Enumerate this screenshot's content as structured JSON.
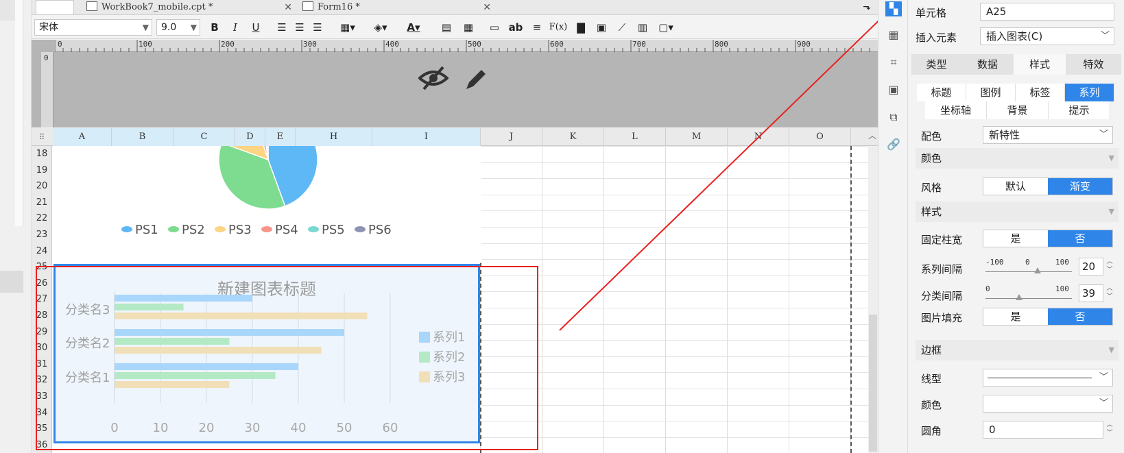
{
  "tabs": [
    {
      "label": "WorkBook7_mobile.cpt *"
    },
    {
      "label": "Form16 *"
    }
  ],
  "toolbar": {
    "font": "宋体",
    "size": "9.0",
    "bold": "B",
    "italic": "I",
    "underline": "U",
    "text_ab": "ab",
    "formula": "F(x)"
  },
  "ruler": {
    "ticks": [
      "0",
      "100",
      "200",
      "300",
      "400",
      "500",
      "600",
      "700",
      "800",
      "900"
    ],
    "vzero": "0"
  },
  "columns": [
    "A",
    "B",
    "C",
    "D",
    "E",
    "H",
    "I",
    "J",
    "K",
    "L",
    "M",
    "N",
    "O"
  ],
  "rows": [
    "18",
    "19",
    "20",
    "21",
    "22",
    "23",
    "24",
    "25",
    "26",
    "27",
    "28",
    "29",
    "30",
    "31",
    "32",
    "33",
    "34",
    "35",
    "36"
  ],
  "pie_legend": [
    "PS1",
    "PS2",
    "PS3",
    "PS4",
    "PS5",
    "PS6"
  ],
  "pie_colors": [
    "#5db8f5",
    "#7ddc8f",
    "#fcd482",
    "#f7958a",
    "#79d8cf",
    "#8d93b5"
  ],
  "chart_data": {
    "type": "bar",
    "title": "新建图表标题",
    "categories": [
      "分类名1",
      "分类名2",
      "分类名3"
    ],
    "series": [
      {
        "name": "系列1",
        "values": [
          40,
          50,
          30
        ],
        "color": "#a9d6fb"
      },
      {
        "name": "系列2",
        "values": [
          35,
          25,
          15
        ],
        "color": "#b3e9c5"
      },
      {
        "name": "系列3",
        "values": [
          25,
          45,
          55
        ],
        "color": "#f1dfb8"
      }
    ],
    "xlim": [
      0,
      60
    ],
    "xticks": [
      "0",
      "10",
      "20",
      "30",
      "40",
      "50",
      "60"
    ],
    "orientation": "horizontal",
    "legend": "right"
  },
  "panel": {
    "cell_label": "单元格",
    "cell_value": "A25",
    "insert_label": "插入元素",
    "insert_value": "插入图表(C)",
    "main_tabs": [
      "类型",
      "数据",
      "样式",
      "特效"
    ],
    "sub_tabs_row1": [
      "标题",
      "图例",
      "标签",
      "系列"
    ],
    "sub_tabs_row2": [
      "坐标轴",
      "背景",
      "提示"
    ],
    "color_scheme_label": "配色",
    "color_scheme_value": "新特性",
    "color_section": "颜色",
    "style_label": "风格",
    "style_options": [
      "默认",
      "渐变"
    ],
    "style_section": "样式",
    "fixed_width_label": "固定柱宽",
    "yes": "是",
    "no": "否",
    "series_gap_label": "系列间隔",
    "series_gap_min": "-100",
    "series_gap_mid": "0",
    "series_gap_max": "100",
    "series_gap_value": "20",
    "category_gap_label": "分类间隔",
    "category_gap_min": "0",
    "category_gap_max": "100",
    "category_gap_value": "39",
    "image_fill_label": "图片填充",
    "border_section": "边框",
    "line_label": "线型",
    "border_color_label": "颜色",
    "radius_label": "圆角",
    "radius_value": "0"
  }
}
